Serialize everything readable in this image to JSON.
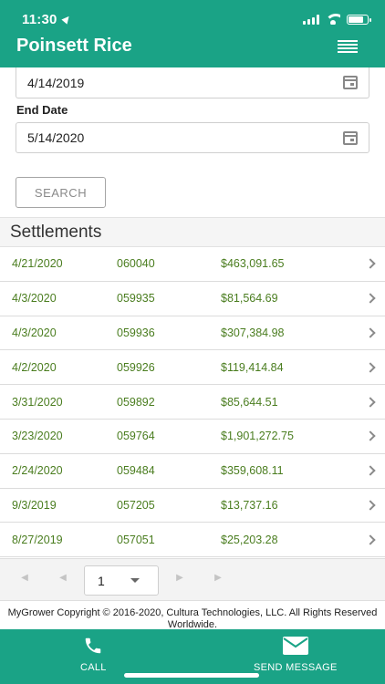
{
  "status_bar": {
    "time": "11:30"
  },
  "header": {
    "title": "Poinsett Rice"
  },
  "filters": {
    "start_date": "4/14/2019",
    "end_date_label": "End Date",
    "end_date": "5/14/2020",
    "search_label": "SEARCH"
  },
  "settlements": {
    "title": "Settlements",
    "rows": [
      {
        "date": "4/21/2020",
        "number": "060040",
        "amount": "$463,091.65"
      },
      {
        "date": "4/3/2020",
        "number": "059935",
        "amount": "$81,564.69"
      },
      {
        "date": "4/3/2020",
        "number": "059936",
        "amount": "$307,384.98"
      },
      {
        "date": "4/2/2020",
        "number": "059926",
        "amount": "$119,414.84"
      },
      {
        "date": "3/31/2020",
        "number": "059892",
        "amount": "$85,644.51"
      },
      {
        "date": "3/23/2020",
        "number": "059764",
        "amount": "$1,901,272.75"
      },
      {
        "date": "2/24/2020",
        "number": "059484",
        "amount": "$359,608.11"
      },
      {
        "date": "9/3/2019",
        "number": "057205",
        "amount": "$13,737.16"
      },
      {
        "date": "8/27/2019",
        "number": "057051",
        "amount": "$25,203.28"
      }
    ]
  },
  "pager": {
    "current_page": "1"
  },
  "footer": {
    "copyright": "MyGrower Copyright © 2016-2020, Cultura Technologies, LLC. All Rights Reserved Worldwide."
  },
  "bottom_nav": {
    "call_label": "CALL",
    "message_label": "SEND MESSAGE"
  },
  "colors": {
    "brand": "#1aa386",
    "row_text": "#4a7d1f"
  }
}
